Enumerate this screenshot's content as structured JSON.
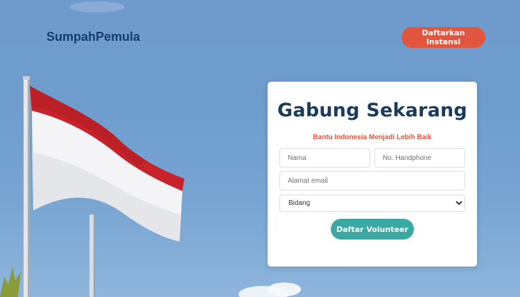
{
  "header": {
    "brand": "SumpahPemula",
    "cta_label": "Daftarkan Instansi"
  },
  "form": {
    "title": "Gabung Sekarang",
    "subtitle": "Bantu Indonesia Menjadi Lebih Baik",
    "name_placeholder": "Nama",
    "phone_placeholder": "No. Handphone",
    "email_placeholder": "Alamat email",
    "field_select_value": "Bidang",
    "submit_label": "Daftar Volunteer"
  },
  "colors": {
    "brand_text": "#173d6a",
    "accent_red": "#e2553f",
    "accent_teal": "#3aa9a3",
    "title_text": "#1b3b5e"
  }
}
